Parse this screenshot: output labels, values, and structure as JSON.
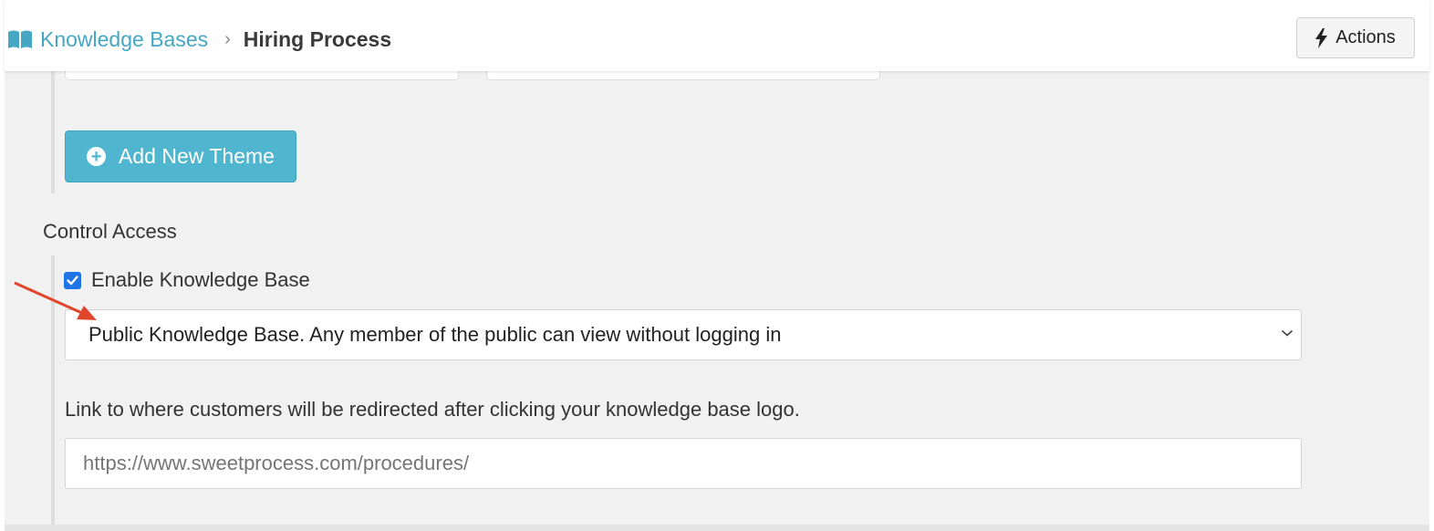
{
  "header": {
    "breadcrumb_root": "Knowledge Bases",
    "breadcrumb_separator": "›",
    "breadcrumb_current": "Hiring Process",
    "actions_label": "Actions"
  },
  "themes": {
    "add_button_label": "Add New Theme"
  },
  "control_access": {
    "title": "Control Access",
    "enable_label": "Enable Knowledge Base",
    "enable_checked": true,
    "visibility_selected": "Public Knowledge Base. Any member of the public can view without logging in",
    "link_help": "Link to where customers will be redirected after clicking your knowledge base logo.",
    "link_placeholder": "https://www.sweetprocess.com/procedures/"
  },
  "colors": {
    "accent": "#50b5cf",
    "link": "#45a7c4",
    "checkbox": "#1f75e8",
    "annotation_arrow": "#e0452b"
  },
  "icons": {
    "breadcrumb": "book-icon",
    "actions": "lightning-icon",
    "add": "plus-circle-icon",
    "select": "chevron-down-icon"
  }
}
